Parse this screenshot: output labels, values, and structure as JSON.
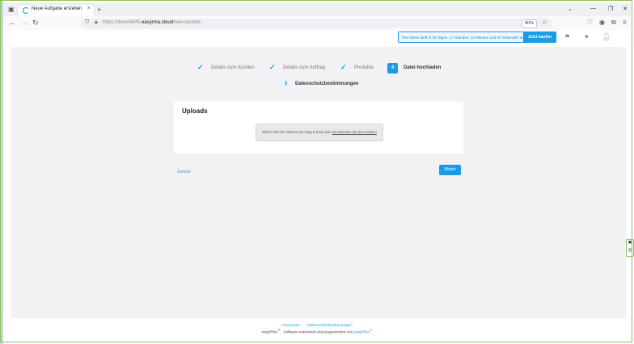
{
  "browser": {
    "tab_title": "Neue Aufgabe erstellen",
    "tab_close": "×",
    "new_tab": "+",
    "url_prefix": "https://demo5845.",
    "url_domain": "easyrma.cloud",
    "url_path": "/new-task/de",
    "zoom": "80%"
  },
  "header": {
    "demo_notice": "Ihre Demo läuft in 16 Tagen, 17 Stunden, 11 Minuten und 40 Sekunden ab",
    "buy_label": "Jetzt kaufen"
  },
  "steps": [
    {
      "label": "Details zum Kunden",
      "status": "done"
    },
    {
      "label": "Details zum Auftrag",
      "status": "done"
    },
    {
      "label": "Produkte",
      "status": "done"
    },
    {
      "number": "4",
      "label": "Datei hochladen",
      "status": "active"
    },
    {
      "number": "5",
      "label": "Datenschutzbestimmungen",
      "status": "pending"
    }
  ],
  "card": {
    "title": "Uploads",
    "drop_text": "Ziehen Sie Ihre Dateien per Drag & Drop oder",
    "drop_link": "durchsuchen Sie Ihre Dateien"
  },
  "actions": {
    "back_label": "Zurück",
    "next_label": "Weiter"
  },
  "footer": {
    "impressum": "Impressum",
    "privacy": "Datenschutzbestimmungen",
    "brand": "easyRMA",
    "trademark": "®",
    "tagline": " - Software entwickelt und programmiert von ",
    "brand_link": "easyRMA",
    "brand_link_mark": "®"
  },
  "colors": {
    "accent": "#1a9be6",
    "frame": "#8fc25a"
  }
}
